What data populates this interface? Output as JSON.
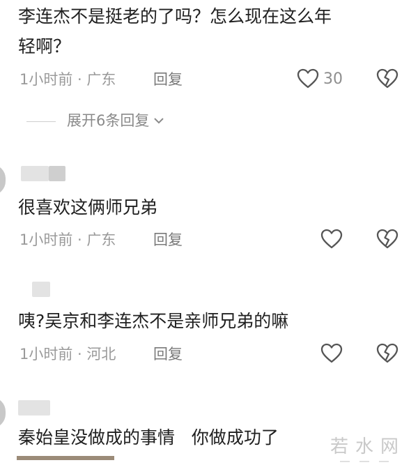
{
  "comments": [
    {
      "text_line1": "李连杰不是挺老的了吗？怎么现在这么年",
      "text_line2": "轻啊？",
      "meta": "1小时前 · 广东",
      "reply": "回复",
      "like_count": "30",
      "expand": "展开6条回复"
    },
    {
      "text": "很喜欢这俩师兄弟",
      "meta": "1小时前 · 广东",
      "reply": "回复"
    },
    {
      "text": "咦?吴京和李连杰不是亲师兄弟的嘛",
      "meta": "1小时前 · 河北",
      "reply": "回复"
    },
    {
      "text": "秦始皇没做成的事情   你做成功了"
    }
  ],
  "watermark": {
    "text": "若水网"
  },
  "icons": {
    "like": "heart-outline-icon",
    "dislike": "broken-heart-icon",
    "expand": "chevron-down-icon"
  },
  "colors": {
    "text": "#202020",
    "meta": "#9a9a9a",
    "icon": "#555555"
  }
}
